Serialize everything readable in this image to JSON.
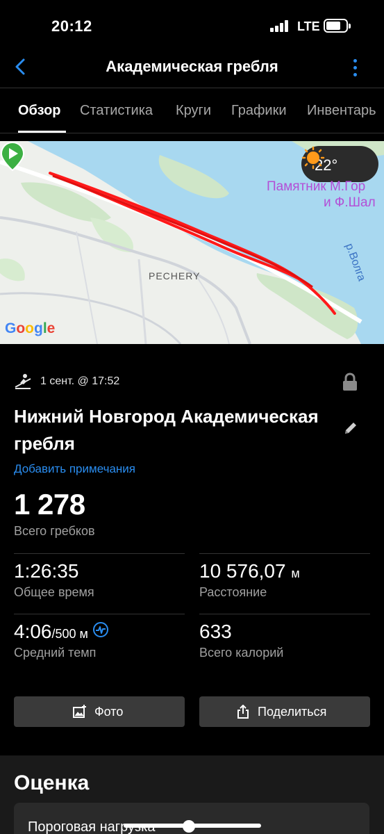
{
  "status_bar": {
    "time": "20:12",
    "network": "LTE"
  },
  "nav": {
    "title": "Академическая гребля"
  },
  "tabs": [
    {
      "label": "Обзор",
      "active": true
    },
    {
      "label": "Статистика",
      "active": false
    },
    {
      "label": "Круги",
      "active": false
    },
    {
      "label": "Графики",
      "active": false
    },
    {
      "label": "Инвентарь",
      "active": false
    }
  ],
  "map": {
    "temperature": "22°",
    "poi_line1": "Памятник М.Гор",
    "poi_line2": "и Ф.Шал",
    "river": "р.Волга",
    "district": "PECHERY",
    "attribution": "Google",
    "route_color": "#ff1a1a"
  },
  "activity": {
    "date": "1 сент. @ 17:52",
    "title": "Нижний Новгород Академическая гребля",
    "add_notes": "Добавить примечания",
    "strokes_value": "1 278",
    "strokes_label": "Всего гребков"
  },
  "stats": {
    "time_value": "1:26:35",
    "time_label": "Общее время",
    "distance_value": "10 576,07",
    "distance_unit": "м",
    "distance_label": "Расстояние",
    "pace_value": "4:06",
    "pace_unit": "/500 м",
    "pace_label": "Средний темп",
    "calories_value": "633",
    "calories_label": "Всего калорий"
  },
  "buttons": {
    "photo": "Фото",
    "share": "Поделиться"
  },
  "rating": {
    "title": "Оценка",
    "card_label": "Пороговая нагрузка"
  },
  "colors": {
    "accent": "#2a8df0",
    "background": "#000000"
  }
}
